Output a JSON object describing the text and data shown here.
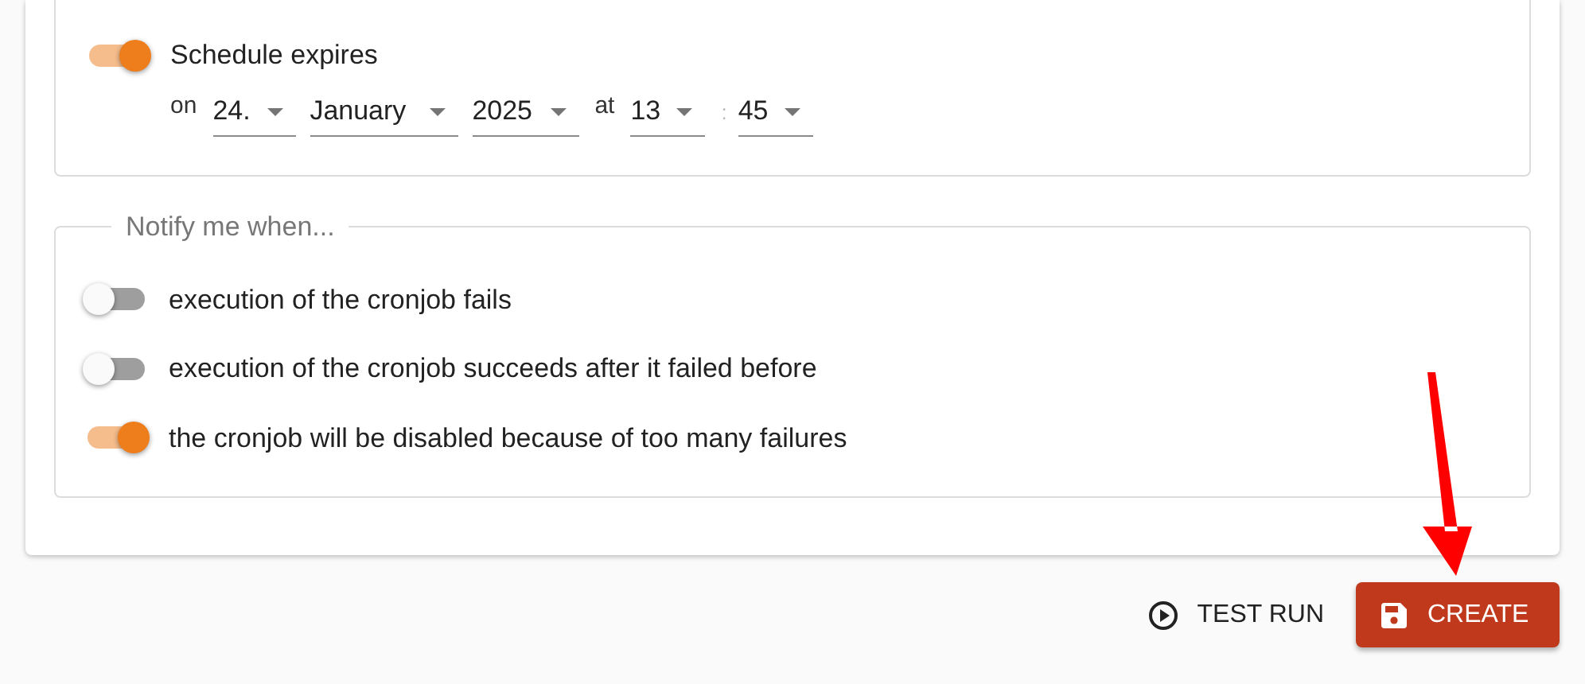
{
  "expiry": {
    "label": "Schedule expires",
    "on": true,
    "on_label": "on",
    "day": "24.",
    "month": "January",
    "year": "2025",
    "at_label": "at",
    "hour": "13",
    "time_separator": ":",
    "minute": "45"
  },
  "notify": {
    "legend": "Notify me when...",
    "options": [
      {
        "label": "execution of the cronjob fails",
        "on": false
      },
      {
        "label": "execution of the cronjob succeeds after it failed before",
        "on": false
      },
      {
        "label": "the cronjob will be disabled because of too many failures",
        "on": true
      }
    ]
  },
  "actions": [
    {
      "kind": "test",
      "label": "TEST RUN"
    },
    {
      "kind": "create",
      "label": "CREATE"
    }
  ]
}
